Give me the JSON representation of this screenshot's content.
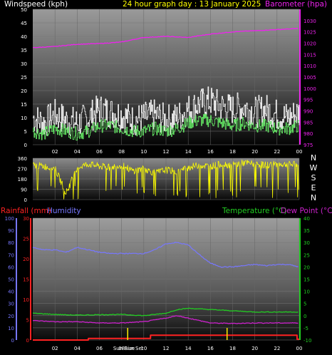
{
  "header": {
    "wind_label": "Windspeed (kph)",
    "title": "24 hour graph day : 13 January 2025",
    "baro_label": "Barometer (hpa)"
  },
  "colors": {
    "wind": "#ffffff",
    "gust_avg": "#66ee66",
    "barometer": "#ee22ee",
    "direction": "#ffff00",
    "rain": "#ff2222",
    "humidity": "#7777ff",
    "temperature": "#22cc22",
    "dewpoint": "#cc22cc",
    "sun": "#ffee00"
  },
  "chart_data": [
    {
      "type": "line",
      "panel": "wind-barometer",
      "x_ticks": [
        "02",
        "04",
        "06",
        "08",
        "10",
        "12",
        "14",
        "16",
        "18",
        "20",
        "22",
        "00"
      ],
      "y_left": {
        "label": "Windspeed (kph)",
        "ylim": [
          0,
          50
        ],
        "ticks": [
          "0",
          "5",
          "10",
          "15",
          "20",
          "25",
          "30",
          "35",
          "40",
          "45",
          "50"
        ]
      },
      "y_right": {
        "label": "Barometer (hpa)",
        "ylim": [
          975,
          1035
        ],
        "ticks": [
          "975",
          "980",
          "985",
          "990",
          "995",
          "1000",
          "1005",
          "1010",
          "1015",
          "1020",
          "1025",
          "1030"
        ]
      },
      "series": [
        {
          "axis": "left",
          "hours": [
            0,
            1,
            2,
            3,
            4,
            5,
            6,
            7,
            8,
            9,
            10,
            11,
            12,
            13,
            14,
            15,
            16,
            17,
            18,
            19,
            20,
            21,
            22,
            23,
            24
          ],
          "values": [
            10,
            8,
            11,
            9,
            8,
            10,
            13,
            12,
            11,
            9,
            10,
            11,
            9,
            10,
            13,
            15,
            16,
            14,
            13,
            14,
            12,
            13,
            11,
            10,
            12
          ]
        },
        {
          "axis": "left",
          "hours": [
            0,
            1,
            2,
            3,
            4,
            5,
            6,
            7,
            8,
            9,
            10,
            11,
            12,
            13,
            14,
            15,
            16,
            17,
            18,
            19,
            20,
            21,
            22,
            23,
            24
          ],
          "values": [
            5,
            4,
            6,
            5,
            4,
            5,
            7,
            7,
            6,
            5,
            5,
            6,
            5,
            6,
            8,
            9,
            9,
            8,
            7,
            8,
            7,
            7,
            6,
            6,
            7
          ]
        },
        {
          "axis": "right",
          "hours": [
            0,
            2,
            4,
            6,
            8,
            10,
            12,
            14,
            16,
            18,
            20,
            22,
            24
          ],
          "values": [
            1018,
            1018.5,
            1019.5,
            1019.8,
            1020.5,
            1022.5,
            1023,
            1022.5,
            1024,
            1025,
            1025.5,
            1026,
            1026.5
          ]
        }
      ]
    },
    {
      "type": "line",
      "panel": "wind-direction",
      "y_ticks": [
        "360",
        "270",
        "180",
        "90",
        "0"
      ],
      "compass": [
        "N",
        "W",
        "S",
        "E",
        "N"
      ],
      "ylim": [
        0,
        360
      ],
      "series": [
        {
          "hours": [
            0,
            1,
            2,
            3,
            4,
            5,
            6,
            7,
            8,
            9,
            10,
            11,
            12,
            13,
            14,
            15,
            16,
            17,
            18,
            19,
            20,
            21,
            22,
            23,
            24
          ],
          "values": [
            300,
            290,
            270,
            60,
            280,
            310,
            290,
            280,
            300,
            250,
            270,
            230,
            260,
            240,
            280,
            300,
            290,
            310,
            300,
            320,
            310,
            300,
            310,
            305,
            310
          ]
        }
      ]
    },
    {
      "type": "line",
      "panel": "rain-humidity-temperature",
      "labels": {
        "rain": "Rainfall (mm)",
        "humidity": "Humidity",
        "temperature": "Temperature (°C)",
        "dewpoint": "Dew Point (°C)"
      },
      "x_ticks": [
        "02",
        "04",
        "06",
        "08",
        "10",
        "12",
        "14",
        "16",
        "18",
        "20",
        "22",
        "00"
      ],
      "sun_markers": [
        "Sun Rise",
        "Sun Set"
      ],
      "humidity_axis": {
        "ylim": [
          0,
          100
        ],
        "ticks": [
          "0",
          "10",
          "20",
          "30",
          "40",
          "50",
          "60",
          "70",
          "80",
          "90",
          "100"
        ]
      },
      "rain_axis": {
        "ylim": [
          0,
          30
        ],
        "ticks": [
          "0",
          "5",
          "10",
          "15",
          "20",
          "25",
          "30"
        ]
      },
      "temp_axis": {
        "ylim": [
          -10,
          40
        ],
        "ticks": [
          "-10",
          "-5",
          "0",
          "5",
          "10",
          "15",
          "20",
          "25",
          "30",
          "35",
          "40"
        ]
      },
      "series": [
        {
          "axis": "humidity",
          "hours": [
            0,
            1,
            2,
            3,
            4,
            5,
            6,
            7,
            8,
            9,
            10,
            11,
            12,
            13,
            14,
            15,
            16,
            17,
            18,
            19,
            20,
            21,
            22,
            23,
            24
          ],
          "values": [
            76,
            74,
            74,
            72,
            76,
            74,
            72,
            71,
            71,
            71,
            71,
            74,
            79,
            80,
            78,
            70,
            63,
            60,
            60,
            61,
            62,
            61,
            62,
            62,
            60
          ]
        },
        {
          "axis": "temp",
          "hours": [
            0,
            2,
            4,
            6,
            8,
            10,
            12,
            13,
            14,
            16,
            18,
            20,
            22,
            24
          ],
          "values": [
            1,
            0.5,
            0.2,
            0.4,
            0.5,
            0,
            1,
            2.5,
            3,
            2.5,
            2,
            1.5,
            1.5,
            1.5
          ]
        },
        {
          "axis": "temp",
          "hours": [
            0,
            2,
            4,
            6,
            8,
            10,
            12,
            13,
            14,
            16,
            18,
            20,
            22,
            24
          ],
          "values": [
            -2,
            -2.5,
            -2.5,
            -3,
            -3,
            -2.5,
            -1,
            0,
            -1,
            -3,
            -3.2,
            -3,
            -3,
            -3
          ]
        },
        {
          "axis": "rain",
          "hours": [
            0,
            5,
            5.01,
            10.6,
            10.61,
            23.8,
            23.81,
            24
          ],
          "values": [
            0,
            0,
            0.4,
            0.4,
            1.2,
            1.2,
            0.2,
            0.2
          ]
        }
      ]
    }
  ]
}
